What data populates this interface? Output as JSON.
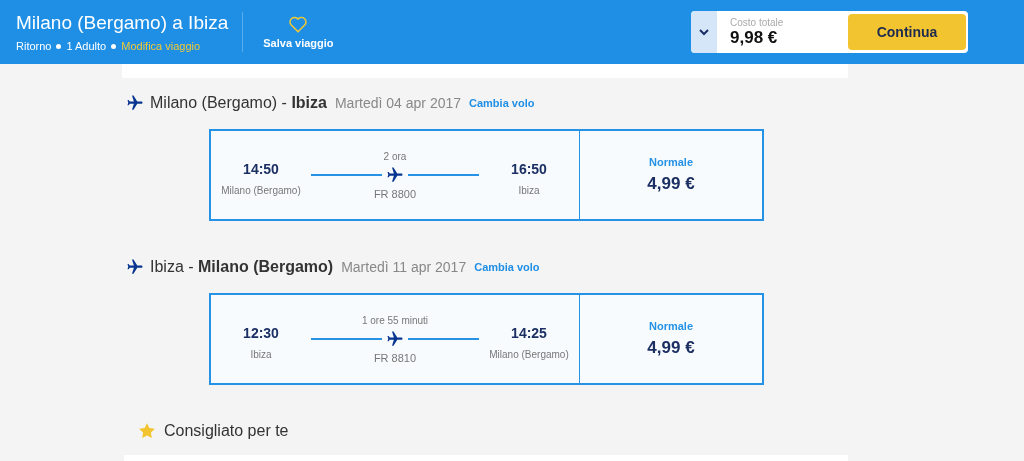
{
  "header": {
    "title": "Milano (Bergamo) a Ibiza",
    "trip_details": [
      "Ritorno",
      "1 Adulto"
    ],
    "edit_link": "Modifica viaggio",
    "save": "Salva viaggio",
    "total_label": "Costo totale",
    "total": "9,98 €",
    "continue": "Continua"
  },
  "flights": [
    {
      "route": "Milano (Bergamo) - **Ibiza**",
      "date": "Martedì 04 apr 2017",
      "change": "Cambia volo",
      "depart_time": "14:50",
      "depart_city": "Milano (Bergamo)",
      "duration": "2 ora",
      "flight_no": "FR 8800",
      "arrive_time": "16:50",
      "arrive_city": "Ibiza",
      "fare": "Normale",
      "price": "4,99 €"
    },
    {
      "route": "Ibiza - **Milano (Bergamo)**",
      "date": "Martedì 11 apr 2017",
      "change": "Cambia volo",
      "depart_time": "12:30",
      "depart_city": "Ibiza",
      "duration": "1 ore 55 minuti",
      "flight_no": "FR 8810",
      "arrive_time": "14:25",
      "arrive_city": "Milano (Bergamo)",
      "fare": "Normale",
      "price": "4,99 €"
    }
  ],
  "recommended": {
    "title": "Consigliato per te"
  }
}
